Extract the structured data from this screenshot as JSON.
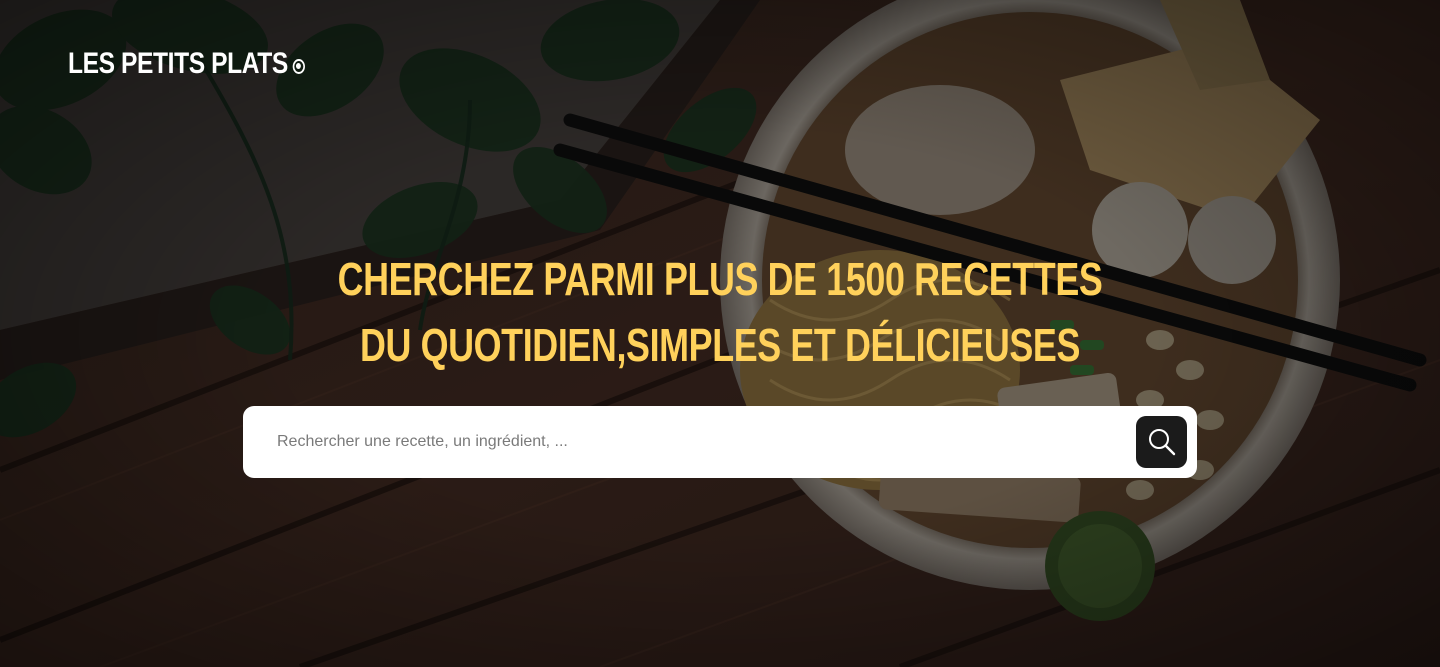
{
  "brand": {
    "name": "LES PETITS PLATS",
    "logo_mark": "circle-dot-icon"
  },
  "hero": {
    "headline_line1": "CHERCHEZ PARMI PLUS DE 1500 RECETTES",
    "headline_line2": "DU QUOTIDIEN,SIMPLES ET DÉLICIEUSES",
    "background": "dark-tinted photo of a bowl of noodles with chopsticks on a wooden table"
  },
  "search": {
    "placeholder": "Rechercher une recette, un ingrédient, ...",
    "value": "",
    "button_icon": "search-icon"
  },
  "colors": {
    "accent": "#FFD15B",
    "text_light": "#FFFFFF",
    "button_dark": "#1B1B1B",
    "placeholder": "#7A7A7A"
  }
}
